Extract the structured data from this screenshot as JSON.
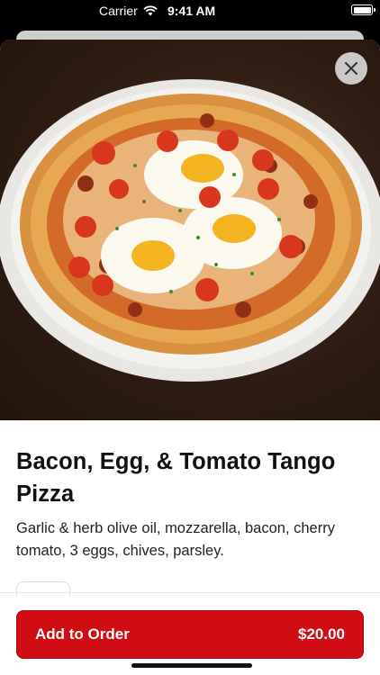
{
  "status_bar": {
    "carrier": "Carrier",
    "time": "9:41 AM"
  },
  "item": {
    "title": "Bacon, Egg, & Tomato Tango Pizza",
    "description": "Garlic & herb olive oil, mozzarella, bacon, cherry tomato, 3 eggs, chives, parsley."
  },
  "order_button": {
    "label": "Add to Order",
    "price": "$20.00"
  },
  "colors": {
    "accent": "#d10d14",
    "image_bg": "#3a2418"
  },
  "icons": {
    "close": "close-icon",
    "wifi": "wifi-icon",
    "battery": "battery-icon"
  }
}
